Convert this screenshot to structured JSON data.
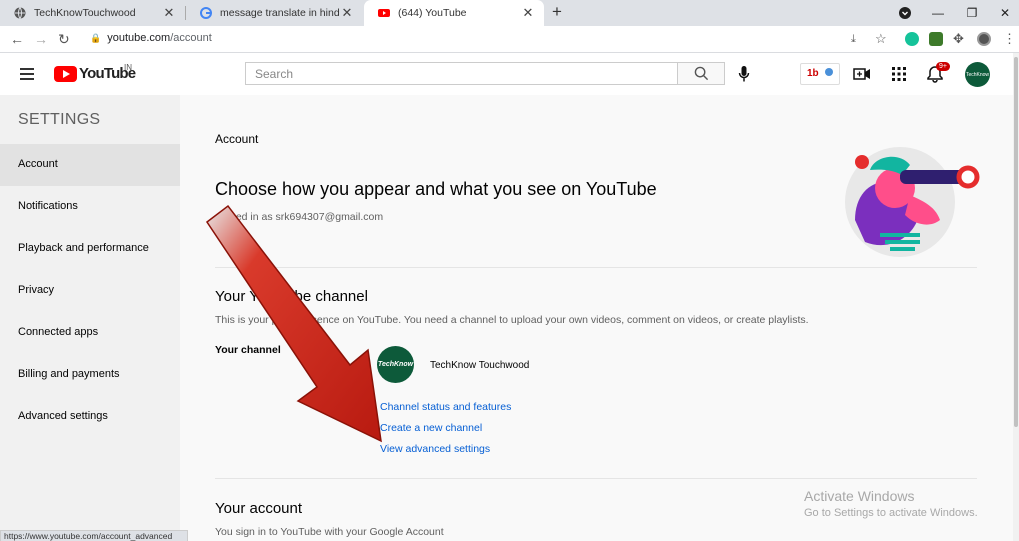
{
  "browser": {
    "tabs": [
      {
        "title": "TechKnowTouchwood",
        "icon": "globe-icon"
      },
      {
        "title": "message translate in hindi - Goo",
        "icon": "google-icon"
      },
      {
        "title": "(644) YouTube",
        "icon": "youtube-icon"
      }
    ],
    "url_host": "youtube.com",
    "url_path": "/account",
    "status_url": "https://www.youtube.com/account_advanced"
  },
  "header": {
    "logo_text": "YouTube",
    "country": "IN",
    "search_placeholder": "Search",
    "ext_label": "1b",
    "notification_count": "9+",
    "avatar_text": "TechKnow"
  },
  "sidebar": {
    "title": "SETTINGS",
    "items": [
      {
        "label": "Account",
        "active": true
      },
      {
        "label": "Notifications"
      },
      {
        "label": "Playback and performance"
      },
      {
        "label": "Privacy"
      },
      {
        "label": "Connected apps"
      },
      {
        "label": "Billing and payments"
      },
      {
        "label": "Advanced settings"
      }
    ]
  },
  "main": {
    "section_label": "Account",
    "heading": "Choose how you appear and what you see on YouTube",
    "signed_in": "ned in as srk694307@gmail.com",
    "channel_heading_a": "Your Yo",
    "channel_heading_b": "ube channel",
    "channel_desc_a": "This is your p",
    "channel_desc_b": "presence on YouTube. You need a channel to upload your own videos, comment on videos, or create playlists.",
    "channel_label": "Your channel",
    "channel_name": "TechKnow Touchwood",
    "channel_avatar_text": "TechKnow",
    "links": [
      "Channel status and features",
      "Create a new channel",
      "View advanced settings"
    ],
    "account_heading": "Your account",
    "account_desc": "You sign in to YouTube with your Google Account"
  },
  "watermark": {
    "line1": "Activate Windows",
    "line2": "Go to Settings to activate Windows."
  }
}
